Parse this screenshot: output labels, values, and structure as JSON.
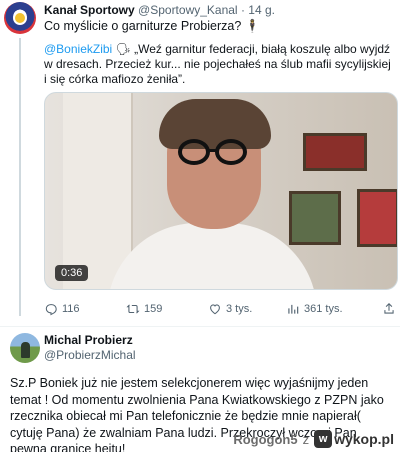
{
  "tweet1": {
    "author": "Kanał Sportowy",
    "handle": "@Sportowy_Kanal",
    "dot": "·",
    "time": "14 g.",
    "text": "Co myślicie o garniturze Probierza? 🕴",
    "quote_mention": "@BoniekZibi",
    "quote_emoji": "🗣",
    "quote_text": " „Weź garnitur federacji, białą koszulę albo wyjdź w dresach. Przecież kur... nie pojechałeś na ślub mafii sycylijskiej i się córka mafiozo żeniła”.",
    "video_duration": "0:36",
    "replies": "116",
    "retweets": "159",
    "likes": "3 tys.",
    "views": "361 tys."
  },
  "tweet2": {
    "author": "Michal Probierz",
    "handle": "@ProbierzMichal",
    "text": "Sz.P Boniek już nie jestem selekcjonerem więc wyjaśnijmy jeden temat ! Od momentu zwolnienia Pana Kwiatkowskiego z PZPN jako rzecznika obiecał mi Pan telefonicznie że będzie mnie napierał( cytuję Pana) że zwalniam Pana ludzi. Przekroczył wczoraj Pan pewną granicę hejtu!"
  },
  "watermark": {
    "user": "Rogogon5",
    "z": "z",
    "site": "wykop.pl"
  },
  "colors": {
    "accent": "#1d9bf0",
    "muted": "#536471"
  }
}
